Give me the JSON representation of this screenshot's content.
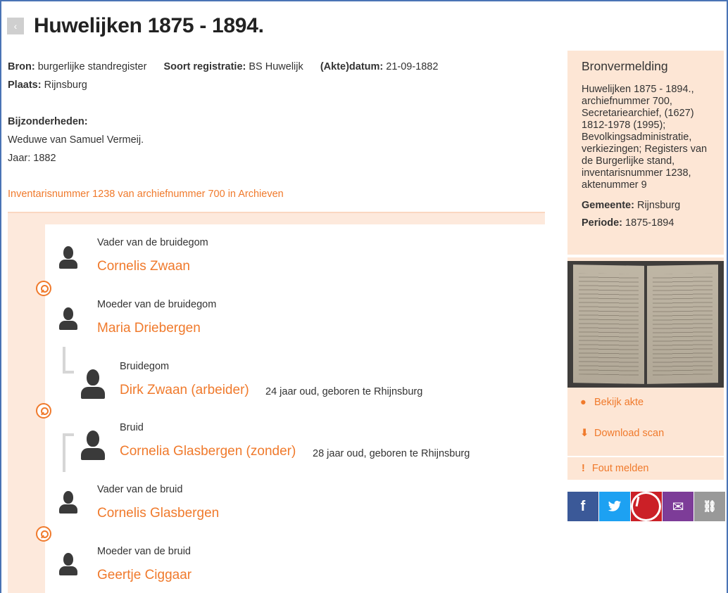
{
  "header": {
    "back_icon": "chevron-left-icon",
    "title": "Huwelijken 1875 - 1894."
  },
  "meta": {
    "bron_label": "Bron:",
    "bron_value": "burgerlijke standregister",
    "soort_label": "Soort registratie:",
    "soort_value": "BS Huwelijk",
    "datum_label": "(Akte)datum:",
    "datum_value": "21-09-1882",
    "plaats_label": "Plaats:",
    "plaats_value": "Rijnsburg"
  },
  "details": {
    "label": "Bijzonderheden:",
    "line1": "Weduwe van Samuel Vermeij.",
    "line2": "Jaar: 1882"
  },
  "inventory_link": "Inventarisnummer 1238 van archiefnummer 700 in Archieven",
  "persons": [
    {
      "role": "Vader van de bruidegom",
      "name": "Cornelis Zwaan",
      "info": ""
    },
    {
      "role": "Moeder van de bruidegom",
      "name": "Maria Driebergen",
      "info": ""
    },
    {
      "role": "Bruidegom",
      "name": "Dirk Zwaan (arbeider)",
      "info": "24 jaar oud, geboren te Rhijnsburg"
    },
    {
      "role": "Bruid",
      "name": "Cornelia Glasbergen (zonder)",
      "info": "28 jaar oud, geboren te Rhijnsburg"
    },
    {
      "role": "Vader van de bruid",
      "name": "Cornelis Glasbergen",
      "info": ""
    },
    {
      "role": "Moeder van de bruid",
      "name": "Geertje Ciggaar",
      "info": ""
    }
  ],
  "bronvermelding": {
    "title": "Bronvermelding",
    "text": "Huwelijken 1875 - 1894., archiefnummer 700, Secretariearchief, (1627) 1812-1978 (1995); Bevolkingsadministratie, verkiezingen; Registers van de Burgerlijke stand, inventarisnummer 1238, aktenummer 9",
    "gemeente_label": "Gemeente:",
    "gemeente_value": "Rijnsburg",
    "periode_label": "Periode:",
    "periode_value": "1875-1894"
  },
  "scan_actions": {
    "view_label": "Bekijk akte",
    "download_label": "Download scan"
  },
  "report": {
    "icon": "!",
    "label": "Fout melden"
  },
  "share": {
    "facebook_glyph": "f",
    "mail_glyph": "✉",
    "link_glyph": "⛓"
  },
  "colors": {
    "accent": "#f07a2c",
    "panel": "#fde6d5",
    "facebook": "#3b5998",
    "twitter": "#1da1f2",
    "pinterest": "#cb2027",
    "mail": "#7d3c98",
    "link": "#999999"
  }
}
